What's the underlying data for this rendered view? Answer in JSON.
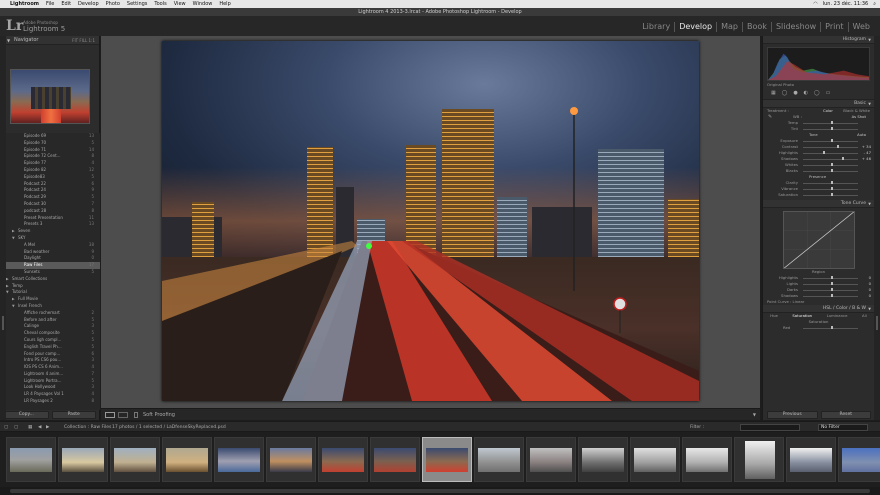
{
  "menubar": {
    "items": [
      "Lightroom",
      "File",
      "Edit",
      "Develop",
      "Photo",
      "Settings",
      "Tools",
      "View",
      "Window",
      "Help"
    ],
    "status": "lun. 23 déc. 11:36"
  },
  "window": {
    "title": "Lightroom 4 2013-3.lrcat - Adobe Photoshop Lightroom - Develop"
  },
  "identity": {
    "logo": "Lr",
    "brand_small": "Adobe Photoshop",
    "brand_big": "Lightroom 5"
  },
  "modules": [
    "Library",
    "Develop",
    "Map",
    "Book",
    "Slideshow",
    "Print",
    "Web"
  ],
  "modules_active": "Develop",
  "left": {
    "navigator_label": "Navigator",
    "navigator_opts": "FIT FILL 1:1",
    "tree": [
      {
        "label": "Episode 69",
        "count": "13",
        "indent": 24,
        "sel": false
      },
      {
        "label": "Episode 70",
        "count": "5",
        "indent": 24,
        "sel": false
      },
      {
        "label": "Episode 71",
        "count": "14",
        "indent": 24,
        "sel": false
      },
      {
        "label": "Episode 72 Cent...",
        "count": "8",
        "indent": 24,
        "sel": false
      },
      {
        "label": "Episode 77",
        "count": "4",
        "indent": 24,
        "sel": false
      },
      {
        "label": "Episode 82",
        "count": "12",
        "indent": 24,
        "sel": false
      },
      {
        "label": "Episode83",
        "count": "5",
        "indent": 24,
        "sel": false
      },
      {
        "label": "Podcast 22",
        "count": "6",
        "indent": 24,
        "sel": false
      },
      {
        "label": "Podcast 24",
        "count": "9",
        "indent": 24,
        "sel": false
      },
      {
        "label": "Podcast 29",
        "count": "5",
        "indent": 24,
        "sel": false
      },
      {
        "label": "Podcast 30",
        "count": "7",
        "indent": 24,
        "sel": false
      },
      {
        "label": "podcast 28",
        "count": "8",
        "indent": 24,
        "sel": false
      },
      {
        "label": "Preset Presentation",
        "count": "11",
        "indent": 24,
        "sel": false
      },
      {
        "label": "Presets 3",
        "count": "13",
        "indent": 24,
        "sel": false
      },
      {
        "label": "Seven",
        "count": "",
        "indent": 18,
        "sel": false,
        "arrow": "▶"
      },
      {
        "label": "SKY",
        "count": "",
        "indent": 18,
        "sel": false,
        "arrow": "▼"
      },
      {
        "label": "A Mel",
        "count": "38",
        "indent": 24,
        "sel": false
      },
      {
        "label": "Bad weather",
        "count": "9",
        "indent": 24,
        "sel": false
      },
      {
        "label": "Daylight",
        "count": "0",
        "indent": 24,
        "sel": false
      },
      {
        "label": "Raw Files",
        "count": "17",
        "indent": 24,
        "sel": true
      },
      {
        "label": "Sunsets",
        "count": "5",
        "indent": 24,
        "sel": false
      },
      {
        "label": "Smart Collections",
        "count": "",
        "indent": 12,
        "sel": false,
        "arrow": "▶"
      },
      {
        "label": "Temp",
        "count": "",
        "indent": 12,
        "sel": false,
        "arrow": "▶"
      },
      {
        "label": "Tutorial",
        "count": "",
        "indent": 12,
        "sel": false,
        "arrow": "▼"
      },
      {
        "label": "Full Movie",
        "count": "",
        "indent": 18,
        "sel": false,
        "arrow": "▶"
      },
      {
        "label": "Insel French",
        "count": "",
        "indent": 18,
        "sel": false,
        "arrow": "▼"
      },
      {
        "label": "Affiche rochemart",
        "count": "2",
        "indent": 24,
        "sel": false
      },
      {
        "label": "Before and after",
        "count": "5",
        "indent": 24,
        "sel": false
      },
      {
        "label": "Calinge",
        "count": "3",
        "indent": 24,
        "sel": false
      },
      {
        "label": "Cheval composite",
        "count": "5",
        "indent": 24,
        "sel": false
      },
      {
        "label": "Cours ligh compl...",
        "count": "5",
        "indent": 24,
        "sel": false
      },
      {
        "label": "English Travel Ph...",
        "count": "5",
        "indent": 24,
        "sel": false
      },
      {
        "label": "Fond pour comp...",
        "count": "6",
        "indent": 24,
        "sel": false
      },
      {
        "label": "Intro PS CS6 pou...",
        "count": "3",
        "indent": 24,
        "sel": false
      },
      {
        "label": "IOS PS CS 6 Anim...",
        "count": "4",
        "indent": 24,
        "sel": false
      },
      {
        "label": "Lightroom 4 anim...",
        "count": "7",
        "indent": 24,
        "sel": false
      },
      {
        "label": "Lightroom Portra...",
        "count": "5",
        "indent": 24,
        "sel": false
      },
      {
        "label": "Look Hollywood",
        "count": "3",
        "indent": 24,
        "sel": false
      },
      {
        "label": "LR 4 Paysages Vol 1",
        "count": "4",
        "indent": 24,
        "sel": false
      },
      {
        "label": "LR Paysages 2",
        "count": "8",
        "indent": 24,
        "sel": false
      }
    ],
    "copy_label": "Copy...",
    "paste_label": "Paste"
  },
  "right": {
    "histogram_label": "Histogram",
    "original_photo": "Original Photo",
    "basic_label": "Basic",
    "treatment": "Treatment :",
    "treatment_color": "Color",
    "treatment_bw": "Black & White",
    "wb_label": "WB :",
    "wb_value": "As Shot",
    "rows": [
      {
        "label": "Temp",
        "value": "",
        "pos": 0.5
      },
      {
        "label": "Tint",
        "value": "",
        "pos": 0.5
      },
      {
        "label": "Tone",
        "value": "Auto",
        "pos": -1
      },
      {
        "label": "Exposure",
        "value": "",
        "pos": 0.5
      },
      {
        "label": "Contrast",
        "value": "+ 34",
        "pos": 0.62
      },
      {
        "label": "Highlights",
        "value": "- 47",
        "pos": 0.36
      },
      {
        "label": "Shadows",
        "value": "+ 46",
        "pos": 0.7
      },
      {
        "label": "Whites",
        "value": "",
        "pos": 0.5
      },
      {
        "label": "Blacks",
        "value": "",
        "pos": 0.5
      },
      {
        "label": "Presence",
        "value": "",
        "pos": -1
      },
      {
        "label": "Clarity",
        "value": "",
        "pos": 0.5
      },
      {
        "label": "Vibrance",
        "value": "",
        "pos": 0.5
      },
      {
        "label": "Saturation",
        "value": "",
        "pos": 0.5
      }
    ],
    "tone_curve_label": "Tone Curve",
    "region_label": "Region",
    "region_rows": [
      {
        "label": "Highlights",
        "value": "0"
      },
      {
        "label": "Lights",
        "value": "0"
      },
      {
        "label": "Darks",
        "value": "0"
      },
      {
        "label": "Shadows",
        "value": "0"
      }
    ],
    "point_curve": "Point Curve : Linear",
    "hsl_label": "HSL / Color / B & W",
    "hsl_tabs": [
      "Hue",
      "Saturation",
      "Luminance",
      "All"
    ],
    "saturation_label": "Saturation",
    "red_label": "Red",
    "previous_label": "Previous",
    "reset_label": "Reset"
  },
  "toolbar": {
    "soft_proofing": "Soft Proofing"
  },
  "filmbar": {
    "source": "Collection : Raw Files",
    "count": "17 photos / 1 selected / LaDfenseSkyReplaced.psd",
    "filter_label": "Filter :",
    "filter_value": "No Filter"
  }
}
